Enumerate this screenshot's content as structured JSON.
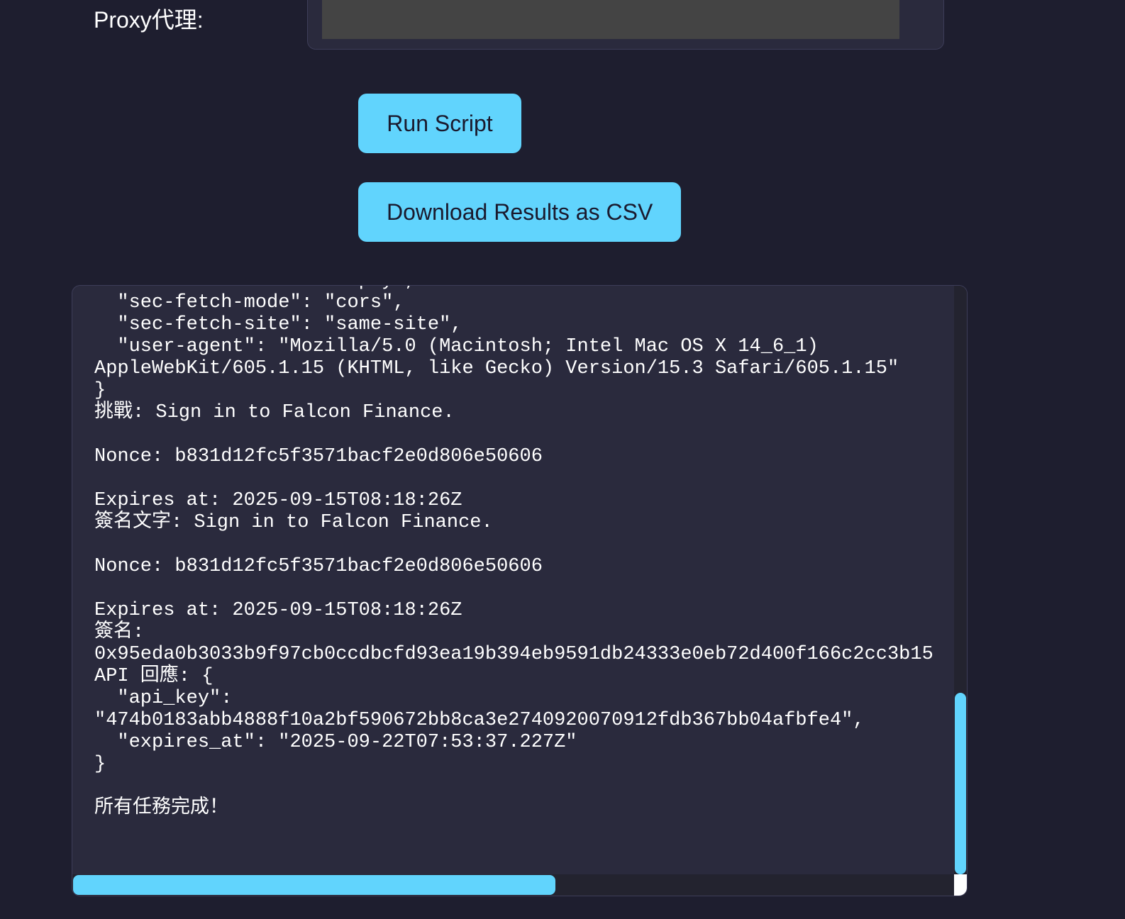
{
  "proxy": {
    "label": "Proxy代理:",
    "value": ""
  },
  "buttons": {
    "run_label": "Run Script",
    "download_label": "Download Results as CSV"
  },
  "output": {
    "text": "  \"sec-fetch-dest\": \"empty\",\n  \"sec-fetch-mode\": \"cors\",\n  \"sec-fetch-site\": \"same-site\",\n  \"user-agent\": \"Mozilla/5.0 (Macintosh; Intel Mac OS X 14_6_1)\nAppleWebKit/605.1.15 (KHTML, like Gecko) Version/15.3 Safari/605.1.15\"\n}\n挑戰: Sign in to Falcon Finance.\n\nNonce: b831d12fc5f3571bacf2e0d806e50606\n\nExpires at: 2025-09-15T08:18:26Z\n簽名文字: Sign in to Falcon Finance.\n\nNonce: b831d12fc5f3571bacf2e0d806e50606\n\nExpires at: 2025-09-15T08:18:26Z\n簽名:\n0x95eda0b3033b9f97cb0ccdbcfd93ea19b394eb9591db24333e0eb72d400f166c2cc3b15\nAPI 回應: {\n  \"api_key\":\n\"474b0183abb4888f10a2bf590672bb8ca3e2740920070912fdb367bb04afbfe4\",\n  \"expires_at\": \"2025-09-22T07:53:37.227Z\"\n}\n\n所有任務完成！"
  },
  "scroll": {
    "vertical_position": 0.69,
    "horizontal_position": 0.0
  },
  "colors": {
    "background": "#1e1e2f",
    "panel": "#2a2a3d",
    "accent": "#61d4fd",
    "input": "#444444"
  }
}
